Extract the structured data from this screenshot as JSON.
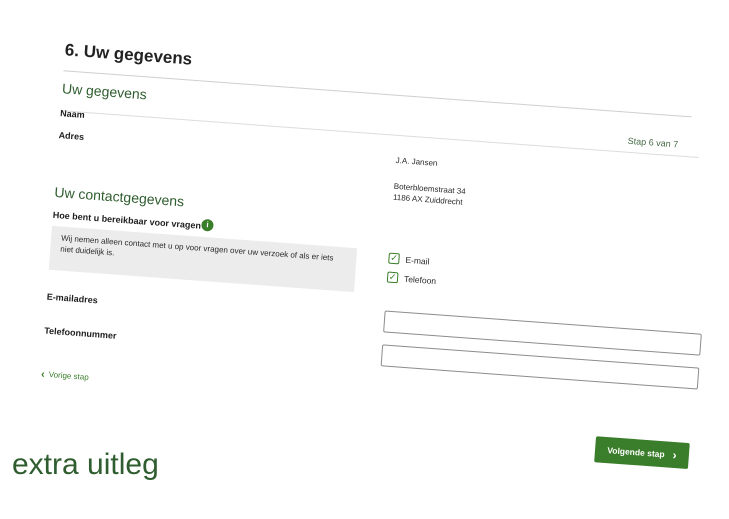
{
  "page": {
    "title": "6. Uw gegevens",
    "step": "Stap 6 van 7"
  },
  "personal": {
    "heading": "Uw gegevens",
    "name_label": "Naam",
    "address_label": "Adres",
    "name_value": "J.A. Jansen",
    "address_line1": "Boterbloemstraat 34",
    "address_line2": "1186 AX Zuiddrecht"
  },
  "contact": {
    "heading": "Uw contactgegevens",
    "question": "Hoe bent u bereikbaar voor vragen?",
    "info_icon": "info-icon",
    "info_text": "Wij nemen alleen contact met u op voor vragen over uw verzoek of als er iets niet duidelijk is.",
    "options": [
      {
        "label": "E-mail",
        "checked": true
      },
      {
        "label": "Telefoon",
        "checked": true
      }
    ],
    "email_label": "E-mailadres",
    "email_value": "",
    "phone_label": "Telefoonnummer",
    "phone_value": ""
  },
  "nav": {
    "prev_label": "Vorige stap",
    "next_label": "Volgende stap",
    "prev_icon": "chevron-left-icon",
    "next_icon": "chevron-right-icon"
  },
  "caption": "extra uitleg",
  "colors": {
    "accent": "#3a7d2a",
    "heading": "#2f5d2f",
    "info_bg": "#ececec"
  }
}
